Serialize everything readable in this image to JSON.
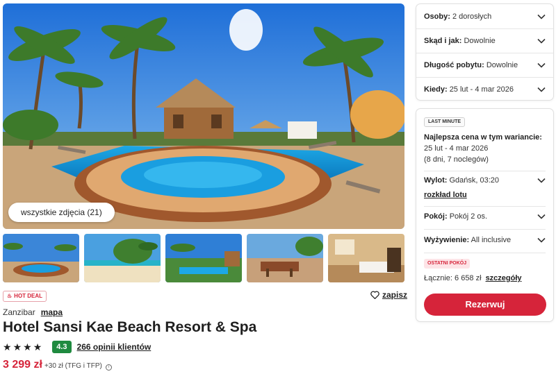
{
  "gallery": {
    "all_photos_label": "wszystkie zdjęcia (21)",
    "thumbnails": [
      "pool",
      "beach-palms",
      "garden-pool",
      "terrace",
      "bedroom"
    ]
  },
  "hotel": {
    "hot_deal_label": "HOT DEAL",
    "save_label": "zapisz",
    "destination": "Zanzibar",
    "map_label": "mapa",
    "name": "Hotel Sansi Kae Beach Resort & Spa",
    "stars": 4,
    "star_glyph": "★",
    "score": "4.3",
    "reviews_label": "266 opinii klientów",
    "price": "3 299 zł",
    "price_extra": "+30 zł (TFG i TFP)",
    "info_icon": "i"
  },
  "search_panel": {
    "persons_label": "Osoby:",
    "persons_value": "2 dorosłych",
    "from_label": "Skąd i jak:",
    "from_value": "Dowolnie",
    "length_label": "Długość pobytu:",
    "length_value": "Dowolnie",
    "when_label": "Kiedy:",
    "when_value": "25 lut - 4 mar 2026"
  },
  "offer_panel": {
    "badge": "LAST MINUTE",
    "best_price_label": "Najlepsza cena w tym wariancie:",
    "dates": "25 lut - 4 mar 2026",
    "nights": "(8 dni, 7 noclegów)",
    "departure_label": "Wylot:",
    "departure_value": "Gdańsk, 03:20",
    "flight_schedule_label": "rozkład lotu",
    "room_label": "Pokój:",
    "room_value": "Pokój 2 os.",
    "board_label": "Wyżywienie:",
    "board_value": "All inclusive",
    "last_room_badge": "OSTATNI POKÓJ",
    "total_label": "Łącznie: 6 658 zł",
    "details_label": "szczegóły",
    "book_label": "Rezerwuj"
  },
  "colors": {
    "accent": "#d6243a",
    "score_bg": "#1f8a3f"
  }
}
